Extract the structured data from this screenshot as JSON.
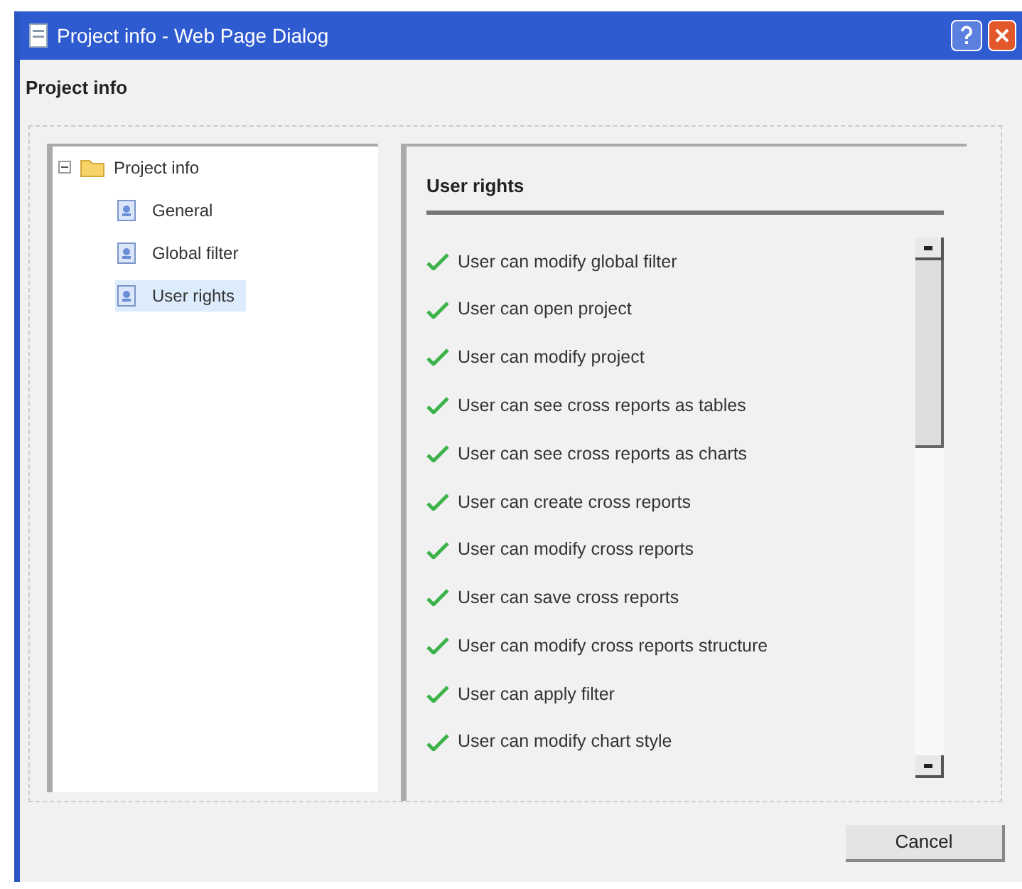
{
  "window": {
    "title": "Project info - Web Page Dialog"
  },
  "header": "Project info",
  "tree": {
    "label": "Project info",
    "expanded": true,
    "children": [
      {
        "label": "General",
        "selected": false
      },
      {
        "label": "Global filter",
        "selected": false
      },
      {
        "label": "User rights",
        "selected": true
      }
    ]
  },
  "panel": {
    "title": "User rights",
    "rights": [
      {
        "label": "User can modify global filter",
        "checked": true
      },
      {
        "label": "User can open project",
        "checked": true
      },
      {
        "label": "User can modify project",
        "checked": true
      },
      {
        "label": "User can see cross reports as tables",
        "checked": true
      },
      {
        "label": "User can see cross reports as charts",
        "checked": true
      },
      {
        "label": "User can create cross reports",
        "checked": true
      },
      {
        "label": "User can modify cross reports",
        "checked": true
      },
      {
        "label": "User can save cross reports",
        "checked": true
      },
      {
        "label": "User can modify cross reports structure",
        "checked": true
      },
      {
        "label": "User can apply filter",
        "checked": true
      },
      {
        "label": "User can modify chart style",
        "checked": true
      }
    ]
  },
  "buttons": [
    "Cancel"
  ]
}
